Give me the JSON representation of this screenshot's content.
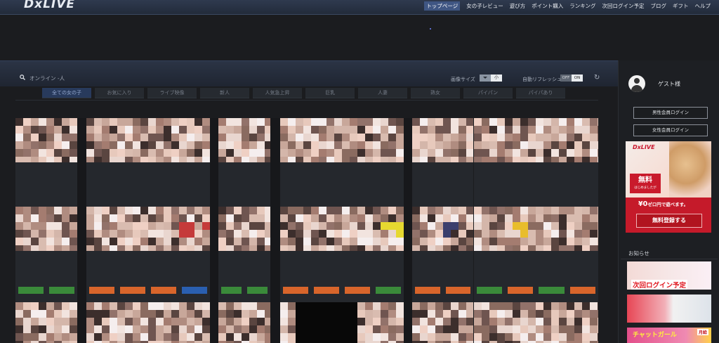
{
  "header": {
    "logo": "DxLIVE",
    "nav": [
      "トップページ",
      "女の子レビュー",
      "遊び方",
      "ポイント購入",
      "ランキング",
      "次回ログイン予定",
      "ブログ",
      "ギフト",
      "ヘルプ"
    ]
  },
  "toolbar": {
    "online": "オンライン -人",
    "image_size_label": "画像サイズ",
    "image_size_value": "小",
    "auto_refresh_label": "自動リフレッシュ",
    "toggle_off": "OFF",
    "toggle_on": "ON",
    "refresh_icon": "refresh-icon"
  },
  "tabs": [
    "全ての女の子",
    "お気に入り",
    "ライブ映像",
    "新人",
    "人気急上昇",
    "巨乳",
    "人妻",
    "熟女",
    "パイパン",
    "パイパあり"
  ],
  "sidebar": {
    "guest": "ゲスト様",
    "male_login": "男性会員ログイン",
    "female_login": "女性会員ログイン",
    "ad": {
      "brand": "DxLIVE",
      "free": "無料",
      "free_sub": "はじめましたが",
      "zero": "¥0",
      "zero_text": "ゼロ円で遊べます。",
      "register": "無料登録する"
    },
    "news_title": "お知らせ",
    "banner1_text": "次回ログイン予定",
    "banner3_text": "チャットガール",
    "banner3_month": "月給"
  },
  "colors": {
    "accent": "#3f5683",
    "tab_active": "#283a5c",
    "ad_red": "#c51a2a",
    "bar_orange": "#d8652b",
    "bar_green": "#3a8a3a",
    "bar_blue": "#2a5fb0"
  }
}
